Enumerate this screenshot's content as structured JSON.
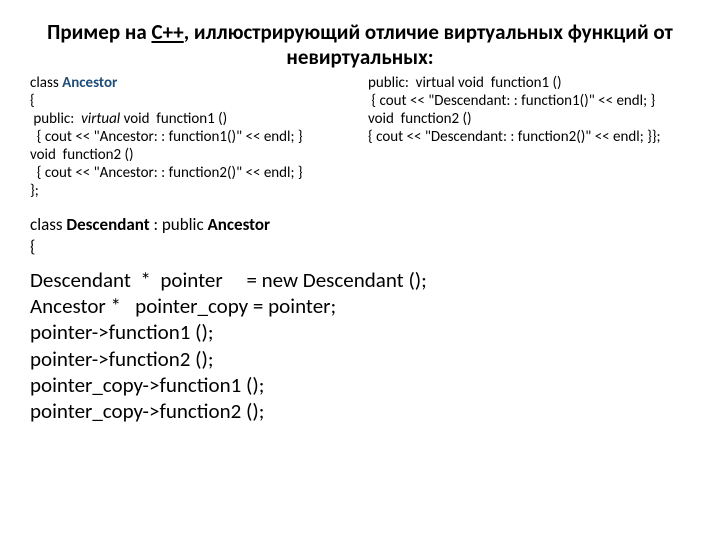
{
  "title_part1": "Пример на ",
  "title_underlined": "C++",
  "title_part2": ", иллюстрирующий отличие виртуальных функций от невиртуальных:",
  "left": {
    "l1a": "class ",
    "l1b": "Ancestor",
    "l2": "{",
    "l3a": " public:  ",
    "l3b": "virtual",
    "l3c": " void  function1 ()",
    "l4": "  { cout << \"Ancestor: : function1()\" << endl; }",
    "l5": "void  function2 ()",
    "l6": "  { cout << \"Ancestor: : function2()\" << endl; }",
    "l7": "};"
  },
  "right": {
    "r1": "public:  virtual void  function1 ()",
    "r2": " { cout << \"Descendant: : function1()\" << endl; }",
    "r3": "void  function2 ()",
    "r4": "{ cout << \"Descendant: : function2()\" << endl; }};"
  },
  "mid": {
    "m1a": "class ",
    "m1b": "Descendant",
    "m1c": " : public ",
    "m1d": "Ancestor",
    "m2": "{"
  },
  "big": {
    "b1": "Descendant  *  pointer     = new Descendant ();",
    "b2": "Ancestor *   pointer_copy = pointer;  ",
    "b3": "pointer->function1 ();  ",
    "b4": "pointer->function2 ();  ",
    "b5": "pointer_copy->function1 ();  ",
    "b6": "pointer_copy->function2 ();  "
  }
}
